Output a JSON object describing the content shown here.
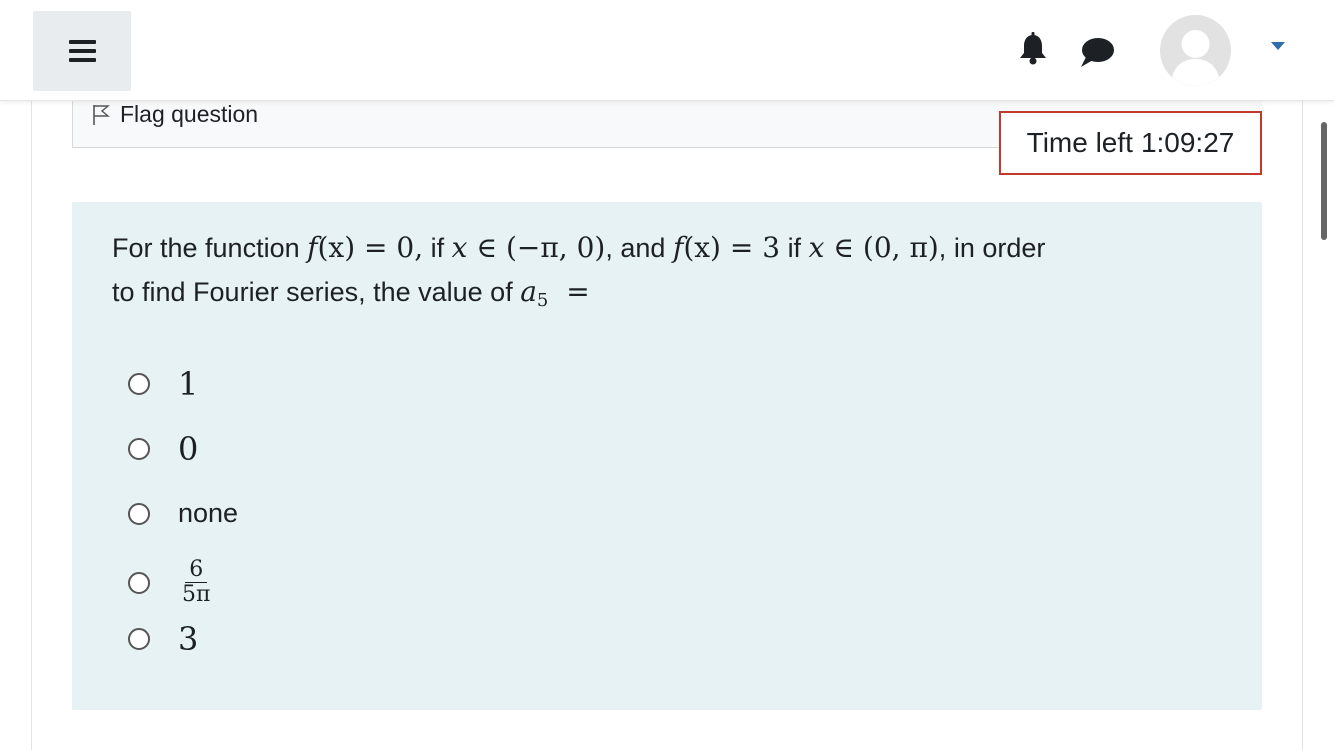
{
  "navbar": {
    "menu_icon": "hamburger-menu-icon",
    "notification_icon": "bell-icon",
    "messages_icon": "chat-bubble-icon",
    "user_avatar_icon": "user-avatar-icon",
    "user_menu_icon": "caret-down-icon"
  },
  "question_info": {
    "flag_label": "Flag question",
    "flag_icon": "flag-outline-icon"
  },
  "timer": {
    "label": "Time left",
    "value": "1:09:27"
  },
  "question": {
    "text_part1": "For the function",
    "f1": "f",
    "x1": "(x)",
    "eq1": "= 0,",
    "if1": "if",
    "x2": "x",
    "in1": "∈",
    "interval1": "(−π, 0)",
    "comma1": ",",
    "and": "and",
    "f2": "f",
    "x3": "(x)",
    "eq2": "= 3",
    "if2": "if",
    "x4": "x",
    "in2": "∈",
    "interval2": "(0, π)",
    "comma2": ",",
    "text_part2": "in order",
    "text_line2": "to find Fourier series, the value of",
    "a": "a",
    "a_sub": "5",
    "eq3": "="
  },
  "answers": {
    "options": [
      {
        "label": "1",
        "selected": false
      },
      {
        "label": "0",
        "selected": false
      },
      {
        "label": "none",
        "selected": false
      },
      {
        "label_num": "6",
        "label_den": "5π",
        "selected": false
      },
      {
        "label": "3",
        "selected": false
      }
    ]
  },
  "colors": {
    "timer_border": "#c0392b",
    "question_bg": "#e7f2f5",
    "caret": "#2f6dae"
  }
}
